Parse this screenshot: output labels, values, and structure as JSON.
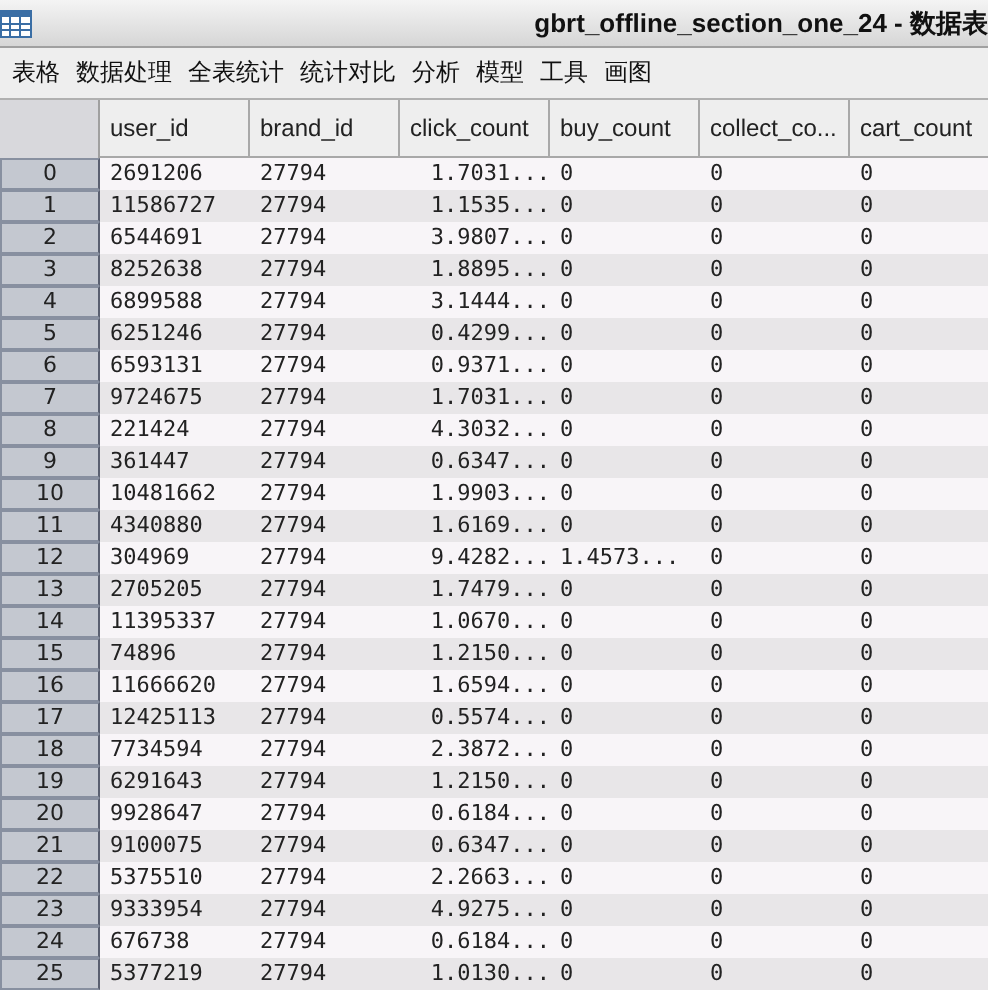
{
  "window": {
    "title": "gbrt_offline_section_one_24 - 数据表"
  },
  "menu": [
    "表格",
    "数据处理",
    "全表统计",
    "统计对比",
    "分析",
    "模型",
    "工具",
    "画图"
  ],
  "table": {
    "columns": [
      "user_id",
      "brand_id",
      "click_count",
      "buy_count",
      "collect_co...",
      "cart_count"
    ],
    "rows": [
      {
        "index": "0",
        "cells": [
          "2691206",
          "27794",
          "1.7031...",
          "0",
          "0",
          "0"
        ]
      },
      {
        "index": "1",
        "cells": [
          "11586727",
          "27794",
          "1.1535...",
          "0",
          "0",
          "0"
        ]
      },
      {
        "index": "2",
        "cells": [
          "6544691",
          "27794",
          "3.9807...",
          "0",
          "0",
          "0"
        ]
      },
      {
        "index": "3",
        "cells": [
          "8252638",
          "27794",
          "1.8895...",
          "0",
          "0",
          "0"
        ]
      },
      {
        "index": "4",
        "cells": [
          "6899588",
          "27794",
          "3.1444...",
          "0",
          "0",
          "0"
        ]
      },
      {
        "index": "5",
        "cells": [
          "6251246",
          "27794",
          "0.4299...",
          "0",
          "0",
          "0"
        ]
      },
      {
        "index": "6",
        "cells": [
          "6593131",
          "27794",
          "0.9371...",
          "0",
          "0",
          "0"
        ]
      },
      {
        "index": "7",
        "cells": [
          "9724675",
          "27794",
          "1.7031...",
          "0",
          "0",
          "0"
        ]
      },
      {
        "index": "8",
        "cells": [
          "221424",
          "27794",
          "4.3032...",
          "0",
          "0",
          "0"
        ]
      },
      {
        "index": "9",
        "cells": [
          "361447",
          "27794",
          "0.6347...",
          "0",
          "0",
          "0"
        ]
      },
      {
        "index": "10",
        "cells": [
          "10481662",
          "27794",
          "1.9903...",
          "0",
          "0",
          "0"
        ]
      },
      {
        "index": "11",
        "cells": [
          "4340880",
          "27794",
          "1.6169...",
          "0",
          "0",
          "0"
        ]
      },
      {
        "index": "12",
        "cells": [
          "304969",
          "27794",
          "9.4282...",
          "1.4573...",
          "0",
          "0"
        ]
      },
      {
        "index": "13",
        "cells": [
          "2705205",
          "27794",
          "1.7479...",
          "0",
          "0",
          "0"
        ]
      },
      {
        "index": "14",
        "cells": [
          "11395337",
          "27794",
          "1.0670...",
          "0",
          "0",
          "0"
        ]
      },
      {
        "index": "15",
        "cells": [
          "74896",
          "27794",
          "1.2150...",
          "0",
          "0",
          "0"
        ]
      },
      {
        "index": "16",
        "cells": [
          "11666620",
          "27794",
          "1.6594...",
          "0",
          "0",
          "0"
        ]
      },
      {
        "index": "17",
        "cells": [
          "12425113",
          "27794",
          "0.5574...",
          "0",
          "0",
          "0"
        ]
      },
      {
        "index": "18",
        "cells": [
          "7734594",
          "27794",
          "2.3872...",
          "0",
          "0",
          "0"
        ]
      },
      {
        "index": "19",
        "cells": [
          "6291643",
          "27794",
          "1.2150...",
          "0",
          "0",
          "0"
        ]
      },
      {
        "index": "20",
        "cells": [
          "9928647",
          "27794",
          "0.6184...",
          "0",
          "0",
          "0"
        ]
      },
      {
        "index": "21",
        "cells": [
          "9100075",
          "27794",
          "0.6347...",
          "0",
          "0",
          "0"
        ]
      },
      {
        "index": "22",
        "cells": [
          "5375510",
          "27794",
          "2.2663...",
          "0",
          "0",
          "0"
        ]
      },
      {
        "index": "23",
        "cells": [
          "9333954",
          "27794",
          "4.9275...",
          "0",
          "0",
          "0"
        ]
      },
      {
        "index": "24",
        "cells": [
          "676738",
          "27794",
          "0.6184...",
          "0",
          "0",
          "0"
        ]
      },
      {
        "index": "25",
        "cells": [
          "5377219",
          "27794",
          "1.0130...",
          "0",
          "0",
          "0"
        ]
      }
    ]
  }
}
